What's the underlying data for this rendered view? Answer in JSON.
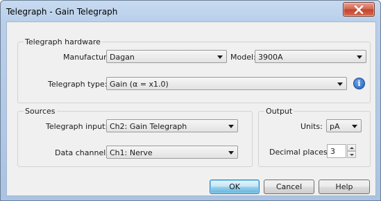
{
  "window": {
    "title": "Telegraph - Gain Telegraph"
  },
  "hardware": {
    "group_label": "Telegraph hardware",
    "manufacturer_label": "Manufacturer:",
    "manufacturer_value": "Dagan",
    "model_label": "Model:",
    "model_value": "3900A",
    "type_label": "Telegraph type:",
    "type_value": "Gain (α = x1.0)"
  },
  "sources": {
    "group_label": "Sources",
    "input_label": "Telegraph input:",
    "input_value": "Ch2: Gain Telegraph",
    "channel_label": "Data channel:",
    "channel_value": "Ch1: Nerve"
  },
  "output": {
    "group_label": "Output",
    "units_label": "Units:",
    "units_value": "pA",
    "decimal_label": "Decimal places:",
    "decimal_value": "3"
  },
  "buttons": {
    "ok": "OK",
    "cancel": "Cancel",
    "help": "Help"
  },
  "icons": {
    "close": "close-icon",
    "info": "info-icon"
  }
}
